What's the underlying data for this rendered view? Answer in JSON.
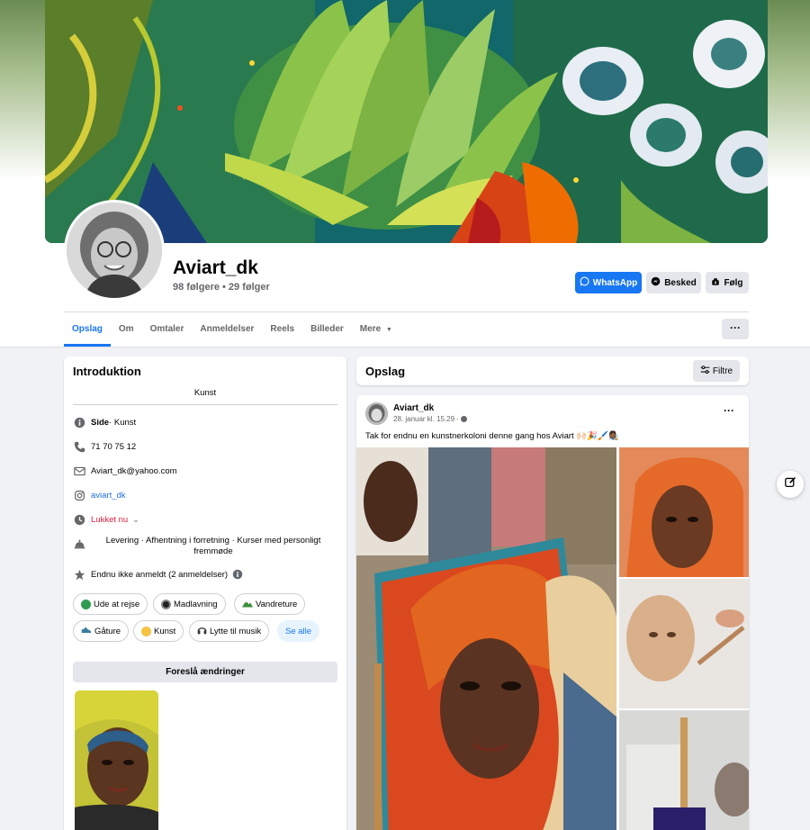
{
  "profile": {
    "name": "Aviart_dk",
    "followers": "98 følgere • 29 følger"
  },
  "actions": {
    "whatsapp": "WhatsApp",
    "message": "Besked",
    "follow": "Følg"
  },
  "tabs": [
    "Opslag",
    "Om",
    "Omtaler",
    "Anmeldelser",
    "Reels",
    "Billeder",
    "Mere"
  ],
  "intro": {
    "title": "Introduktion",
    "bio": "Kunst",
    "page_type_label": "Side",
    "page_type_value": " · Kunst",
    "phone": "71 70 75 12",
    "email": "Aviart_dk@yahoo.com",
    "instagram": "aviart_dk",
    "hours": "Lukket nu",
    "services": "Levering · Afhentning i forretning · Kurser med personligt fremmøde",
    "rating": "Endnu ikke anmeldt (2 anmeldelser)",
    "interests": [
      "Ude at rejse",
      "Madlavning",
      "Vandreture",
      "Gåture",
      "Kunst",
      "Lytte til musik"
    ],
    "see_all": "Se alle",
    "suggest": "Foreslå ændringer"
  },
  "posts": {
    "title": "Opslag",
    "filter": "Filtre"
  },
  "post": {
    "author": "Aviart_dk",
    "date": "28. januar kl. 15.29 · ",
    "text": "Tak for endnu en kunstnerkoloni denne gang hos Aviart 🙌🏻🎉🖌️👩🏾‍🎨"
  },
  "colors": {
    "accent": "#1877f2",
    "closed": "#e41e3f",
    "link": "#216fdb"
  }
}
